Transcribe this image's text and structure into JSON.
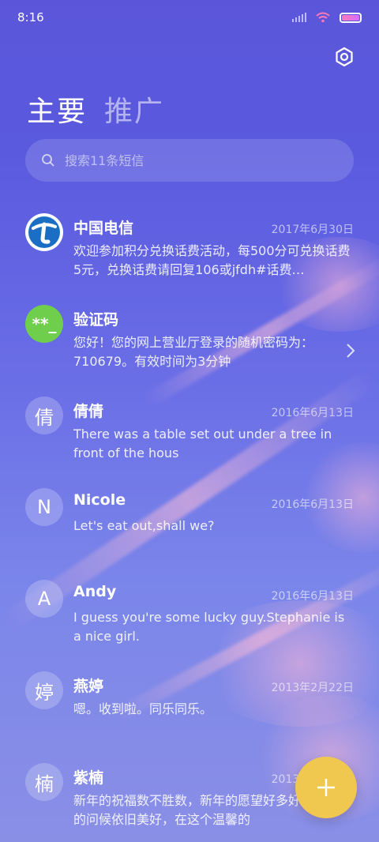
{
  "status_bar": {
    "time": "8:16"
  },
  "header": {
    "tabs": [
      {
        "label": "主要",
        "active": true
      },
      {
        "label": "推广",
        "active": false
      }
    ],
    "settings_icon": "gear-icon"
  },
  "search": {
    "placeholder": "搜索11条短信"
  },
  "messages": [
    {
      "sender": "中国电信",
      "date": "2017年6月30日",
      "preview": "欢迎参加积分兑换话费活动，每500分可兑换话费5元，兑换话费请回复106或jfdh#话费…",
      "avatar_type": "telecom-logo"
    },
    {
      "sender": "验证码",
      "date": "",
      "preview": "您好！您的网上营业厅登录的随机密码为：710679。有效时间为3分钟",
      "avatar_text": "**_",
      "avatar_type": "code"
    },
    {
      "sender": "倩倩",
      "date": "2016年6月13日",
      "preview": "There was a table set out under a tree in front of the hous",
      "avatar_text": "倩"
    },
    {
      "sender": "Nicole",
      "date": "2016年6月13日",
      "preview": "Let's eat out,shall we?",
      "avatar_text": "N"
    },
    {
      "sender": "Andy",
      "date": "2016年6月13日",
      "preview": "I guess you're some lucky guy.Stephanie is a nice girl.",
      "avatar_text": "A"
    },
    {
      "sender": "燕婷",
      "date": "2013年2月22日",
      "preview": "嗯。收到啦。同乐同乐。",
      "avatar_text": "婷"
    },
    {
      "sender": "紫楠",
      "date": "2013年2月22日",
      "preview": "新年的祝福数不胜数，新年的愿望好多好多，新年的问候依旧美好，在这个温馨的",
      "avatar_text": "楠"
    }
  ],
  "fab": {
    "label": "+",
    "icon": "plus-icon"
  },
  "colors": {
    "fab": "#f1c84f",
    "code_avatar": "#6fcf4d",
    "telecom_blue": "#1a6fc4"
  }
}
